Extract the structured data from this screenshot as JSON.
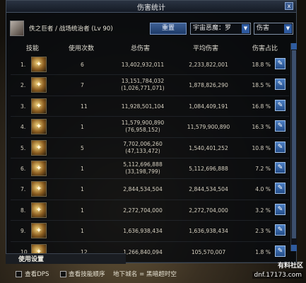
{
  "window": {
    "title": "伤害统计",
    "close_label": "x"
  },
  "player": {
    "name": "佚之巨者 / 战场统治者 (Lv 90)"
  },
  "toolbar": {
    "reset_label": "重置",
    "dungeon_value": "宇宙恶魔：罗",
    "sort_value": "伤害",
    "arrow": "▼"
  },
  "table": {
    "headers": {
      "skill": "技能",
      "count": "使用次数",
      "total": "总伤害",
      "avg": "平均伤害",
      "pct": "伤害占比"
    },
    "rows": [
      {
        "idx": "1.",
        "count": "6",
        "total": "13,402,932,011",
        "total_sub": "",
        "avg": "2,233,822,001",
        "pct": "18.8 %",
        "icon": "burst-icon"
      },
      {
        "idx": "2.",
        "count": "7",
        "total": "13,151,784,032",
        "total_sub": "(1,026,771,071)",
        "avg": "1,878,826,290",
        "pct": "18.5 %",
        "icon": "dash-icon"
      },
      {
        "idx": "3.",
        "count": "11",
        "total": "11,928,501,104",
        "total_sub": "",
        "avg": "1,084,409,191",
        "pct": "16.8 %",
        "icon": "flame-icon"
      },
      {
        "idx": "4.",
        "count": "1",
        "total": "11,579,900,890",
        "total_sub": "(76,958,152)",
        "avg": "11,579,900,890",
        "pct": "16.3 %",
        "icon": "spirit-icon"
      },
      {
        "idx": "5.",
        "count": "5",
        "total": "7,702,006,260",
        "total_sub": "(47,133,472)",
        "avg": "1,540,401,252",
        "pct": "10.8 %",
        "icon": "slash-icon"
      },
      {
        "idx": "6.",
        "count": "1",
        "total": "5,112,696,888",
        "total_sub": "(33,198,799)",
        "avg": "5,112,696,888",
        "pct": "7.2 %",
        "icon": "sword-icon"
      },
      {
        "idx": "7.",
        "count": "1",
        "total": "2,844,534,504",
        "total_sub": "",
        "avg": "2,844,534,504",
        "pct": "4.0 %",
        "icon": "whirl-icon"
      },
      {
        "idx": "8.",
        "count": "1",
        "total": "2,272,704,000",
        "total_sub": "",
        "avg": "2,272,704,000",
        "pct": "3.2 %",
        "icon": "orb-icon"
      },
      {
        "idx": "9.",
        "count": "1",
        "total": "1,636,938,434",
        "total_sub": "",
        "avg": "1,636,938,434",
        "pct": "2.3 %",
        "icon": "strike-icon"
      },
      {
        "idx": "10.",
        "count": "12",
        "total": "1,266,840,094",
        "total_sub": "",
        "avg": "105,570,007",
        "pct": "1.8 %",
        "icon": "bomb-icon"
      }
    ],
    "detail_glyph": "✎"
  },
  "settings": {
    "label": "使用设置"
  },
  "bottom": {
    "show_dps": "查看DPS",
    "show_order": "查看技能顺序",
    "dungeon": "地下城名 = 黑暗超时空"
  },
  "watermarks": {
    "top": "有料社区",
    "site": "dnf.17173.com"
  }
}
